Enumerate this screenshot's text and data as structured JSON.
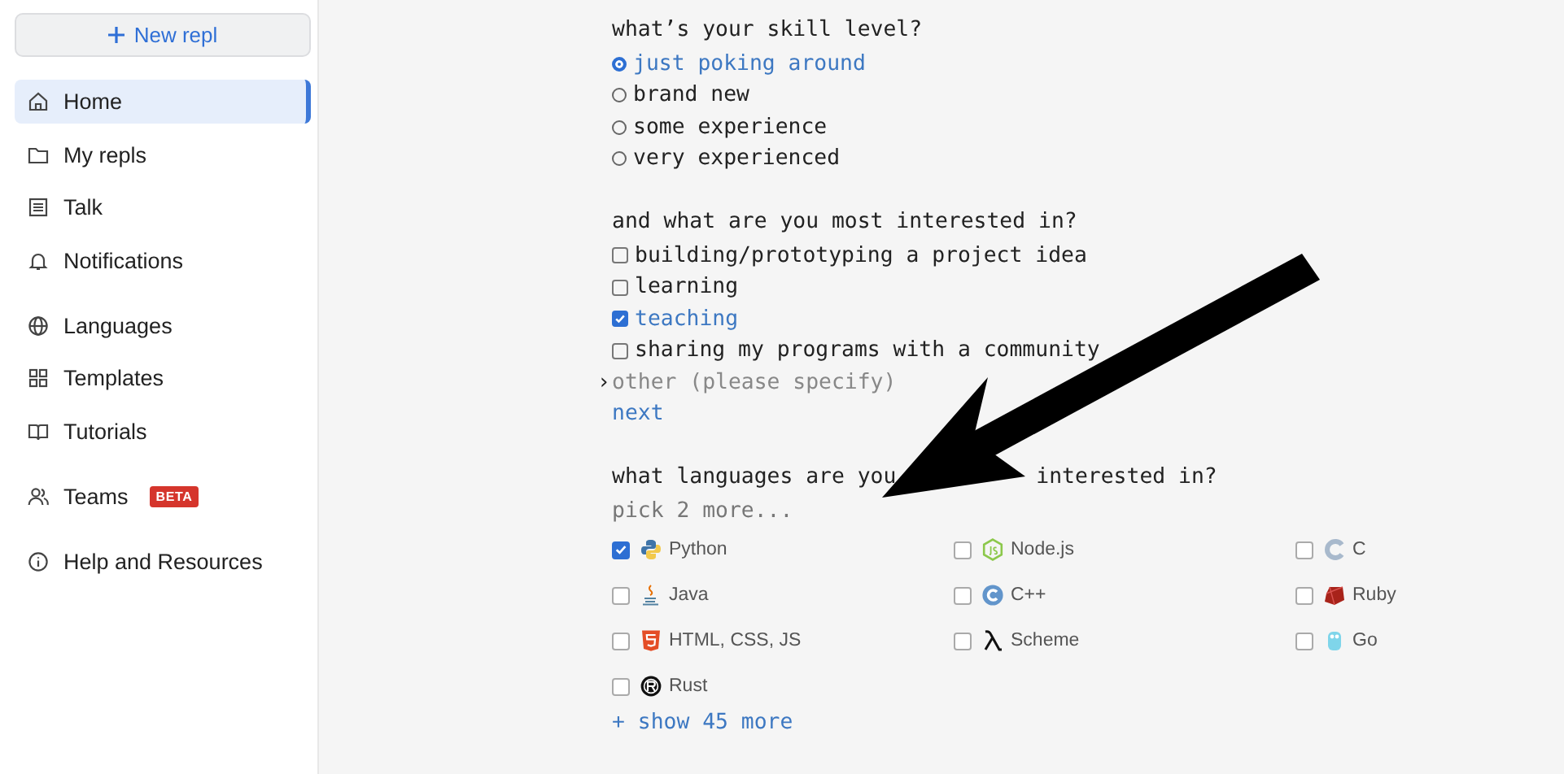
{
  "sidebar": {
    "new_button": "New repl",
    "groups": [
      [
        {
          "label": "Home",
          "selected": true
        },
        {
          "label": "My repls",
          "selected": false
        },
        {
          "label": "Talk",
          "selected": false
        },
        {
          "label": "Notifications",
          "selected": false
        }
      ],
      [
        {
          "label": "Languages",
          "selected": false
        },
        {
          "label": "Templates",
          "selected": false
        },
        {
          "label": "Tutorials",
          "selected": false
        }
      ],
      [
        {
          "label": "Teams",
          "selected": false,
          "badge": "BETA"
        }
      ],
      [
        {
          "label": "Help and Resources",
          "selected": false
        }
      ]
    ]
  },
  "skill": {
    "question": "what’s your skill level?",
    "options": [
      {
        "label": "just poking around",
        "selected": true
      },
      {
        "label": "brand new",
        "selected": false
      },
      {
        "label": "some experience",
        "selected": false
      },
      {
        "label": "very experienced",
        "selected": false
      }
    ]
  },
  "interests": {
    "question": "and what are you most interested in?",
    "options": [
      {
        "label": "building/prototyping a project idea",
        "checked": false
      },
      {
        "label": "learning",
        "checked": false
      },
      {
        "label": "teaching",
        "checked": true
      },
      {
        "label": "sharing my programs with a community",
        "checked": false
      }
    ],
    "other": {
      "prompt": "›",
      "placeholder": "other (please specify)"
    },
    "next": "next"
  },
  "languages": {
    "question_parts": [
      "what languages are you",
      "interested in?"
    ],
    "hint": "pick 2 more...",
    "items": [
      {
        "label": "Python",
        "checked": true
      },
      {
        "label": "Node.js",
        "checked": false
      },
      {
        "label": "C",
        "checked": false
      },
      {
        "label": "Java",
        "checked": false
      },
      {
        "label": "C++",
        "checked": false
      },
      {
        "label": "Ruby",
        "checked": false
      },
      {
        "label": "HTML, CSS, JS",
        "checked": false
      },
      {
        "label": "Scheme",
        "checked": false
      },
      {
        "label": "Go",
        "checked": false
      },
      {
        "label": "Rust",
        "checked": false
      }
    ],
    "show_more": "+ show 45 more"
  }
}
